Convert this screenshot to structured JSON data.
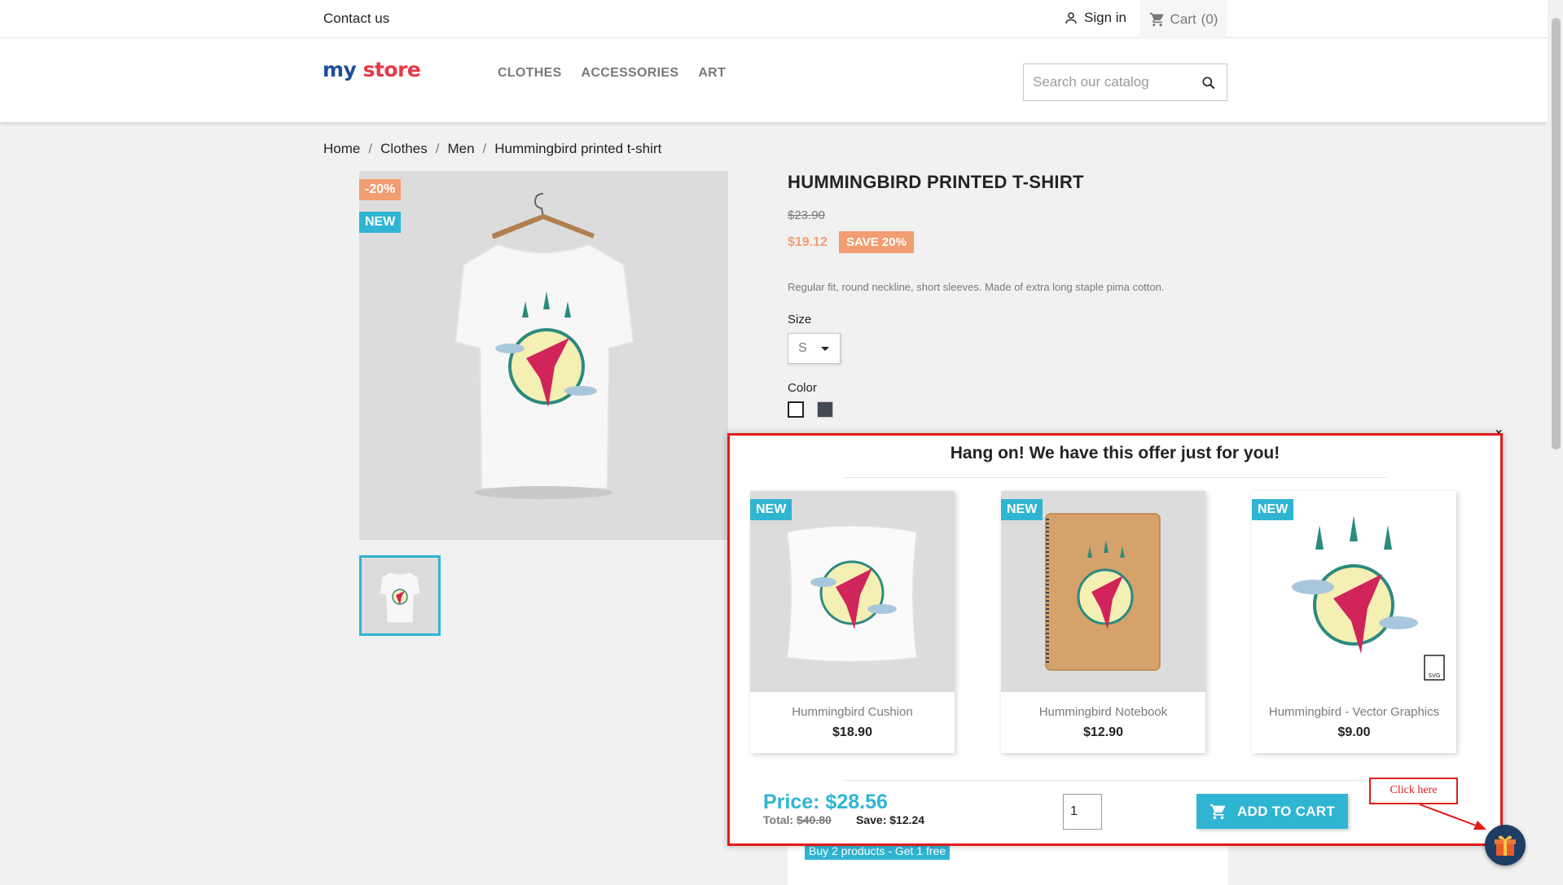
{
  "topbar": {
    "contact": "Contact us",
    "signin": "Sign in",
    "cart": "Cart",
    "cart_count": "(0)"
  },
  "header": {
    "logo": {
      "my": "my",
      "store": "store"
    },
    "nav": [
      "CLOTHES",
      "ACCESSORIES",
      "ART"
    ],
    "search_placeholder": "Search our catalog"
  },
  "breadcrumb": [
    "Home",
    "Clothes",
    "Men",
    "Hummingbird printed t-shirt"
  ],
  "product": {
    "discount_badge": "-20%",
    "new_badge": "NEW",
    "title": "HUMMINGBIRD PRINTED T-SHIRT",
    "old_price": "$23.90",
    "price": "$19.12",
    "save_badge": "SAVE 20%",
    "description": "Regular fit, round neckline, short sleeves. Made of extra long staple pima cotton.",
    "size_label": "Size",
    "size_value": "S",
    "color_label": "Color",
    "colors": [
      "#ffffff",
      "#434a54"
    ],
    "promo": "Buy 2 products - Get 1 free"
  },
  "popup": {
    "title": "Hang on! We have this offer just for you!",
    "products": [
      {
        "badge": "NEW",
        "name": "Hummingbird Cushion",
        "price": "$18.90"
      },
      {
        "badge": "NEW",
        "name": "Hummingbird Notebook",
        "price": "$12.90"
      },
      {
        "badge": "NEW",
        "name": "Hummingbird - Vector Graphics",
        "price": "$9.00",
        "file_tag": "SVG"
      }
    ],
    "bundle_price": "Price: $28.56",
    "total_label": "Total:",
    "total_value": "$40.80",
    "save_text": "Save: $12.24",
    "quantity": "1",
    "add_to_cart": "ADD TO CART",
    "close": "×"
  },
  "annotation": {
    "click_here": "Click here"
  },
  "colors": {
    "accent": "#2fb5d2",
    "discount": "#f39d72",
    "annotation_red": "#e21a1a"
  }
}
